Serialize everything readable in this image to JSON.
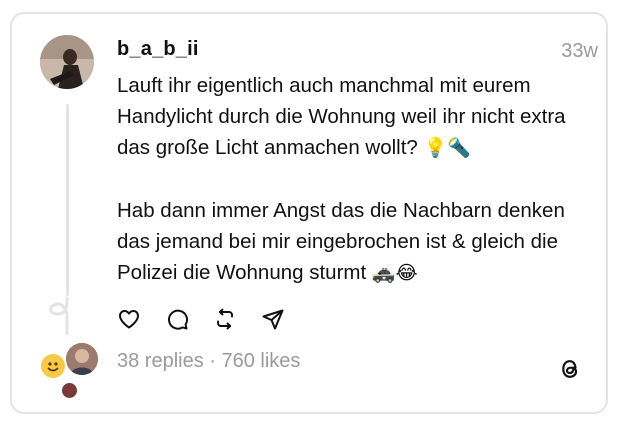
{
  "post": {
    "username": "b_a_b_ii",
    "time": "33w",
    "paragraph1": "Lauft ihr eigentlich auch manchmal mit eurem Handylicht durch die Wohnung weil ihr nicht extra das große Licht anmachen wollt?",
    "paragraph1_emoji": "💡🔦",
    "paragraph2": "Hab dann immer Angst das die Nachbarn denken das jemand bei mir eingebrochen ist & gleich die Polizei die Wohnung sturmt",
    "paragraph2_emoji": "🚓😂"
  },
  "actions": {
    "like_icon": "heart-icon",
    "reply_icon": "comment-bubble-icon",
    "repost_icon": "repost-icon",
    "share_icon": "send-icon"
  },
  "footer": {
    "stats": "38 replies · 760 likes",
    "logo": "threads-logo-icon"
  },
  "colors": {
    "muted_text": "#9a9a9a",
    "border": "#e4e4e4",
    "thread_line": "#e3e3e3"
  }
}
